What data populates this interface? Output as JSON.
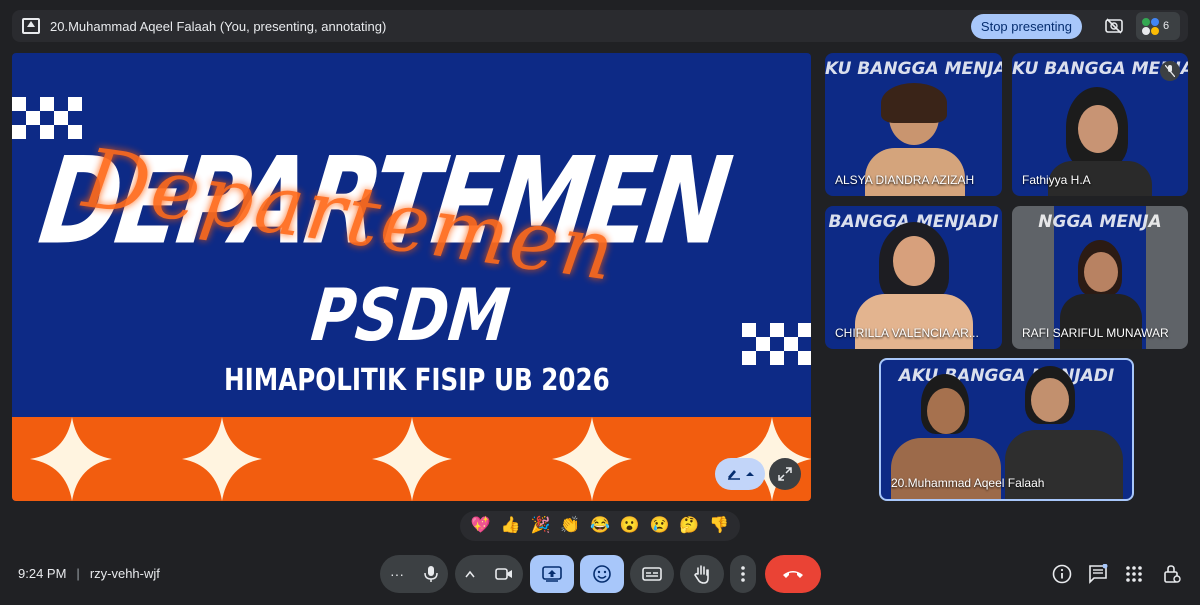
{
  "topbar": {
    "presenting_title": "20.Muhammad Aqeel Falaah (You, presenting, annotating)",
    "stop_presenting_label": "Stop presenting",
    "participant_count": "6"
  },
  "slide": {
    "heading": "DEPARTEMEN",
    "script_heading": "Departemen",
    "psdm": "PSDM",
    "subtitle": "HIMAPOLITIK FISIP UB 2026"
  },
  "tiles": [
    {
      "name": "ALSYA DIANDRA AZIZAH",
      "banner": "KU BANGGA MENJADI ST"
    },
    {
      "name": "Fathiyya H.A",
      "banner": "KU BANGGA MENJADI ST"
    },
    {
      "name": "CHIRILLA VALENCIA AR...",
      "banner": "BANGGA MENJADI"
    },
    {
      "name": "RAFI SARIFUL MUNAWAR",
      "banner": "NGGA MENJA"
    },
    {
      "name": "20.Muhammad Aqeel Falaah",
      "banner": "AKU BANGGA MENJADI"
    }
  ],
  "reactions": [
    "💖",
    "👍",
    "🎉",
    "👏",
    "😂",
    "😮",
    "😢",
    "🤔",
    "👎"
  ],
  "bottom": {
    "time": "9:24 PM",
    "meeting_code": "rzy-vehh-wjf"
  },
  "colors": {
    "background": "#202124",
    "slide_blue": "#0d2a86",
    "slide_orange": "#f25d0f",
    "accent_blue": "#a8c7fa",
    "end_call_red": "#ea4335"
  },
  "icons": [
    "present-screen-icon",
    "camera-off-icon",
    "mic-icon",
    "camera-icon",
    "present-icon",
    "emoji-icon",
    "captions-icon",
    "raise-hand-icon",
    "more-vert-icon",
    "end-call-icon",
    "info-icon",
    "chat-icon",
    "apps-icon",
    "host-controls-icon"
  ]
}
